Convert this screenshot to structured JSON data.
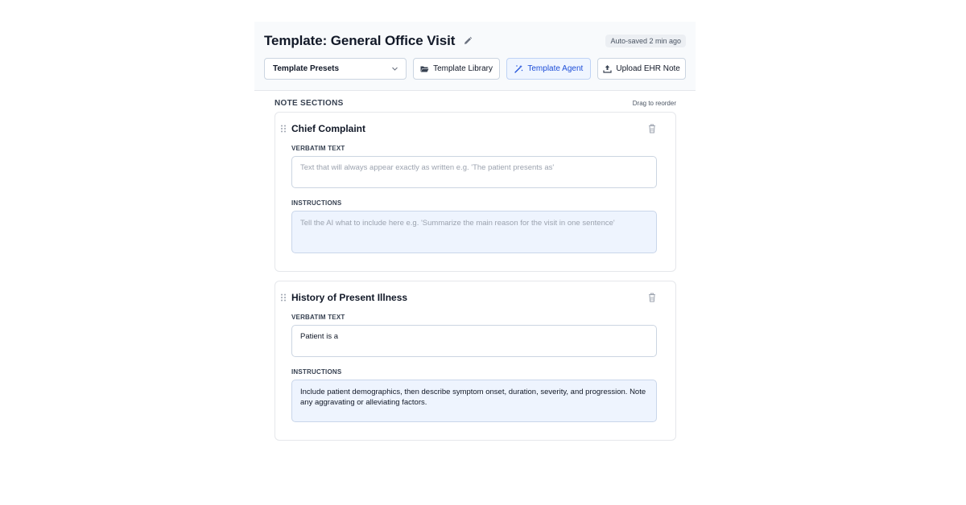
{
  "header": {
    "title": "Template: General Office Visit",
    "autosave": "Auto-saved 2 min ago"
  },
  "toolbar": {
    "preset_select": "Template Presets",
    "library_label": "Template Library",
    "agent_label": "Template Agent",
    "upload_label": "Upload EHR Note"
  },
  "sections": {
    "heading": "NOTE SECTIONS",
    "drag_hint": "Drag to reorder",
    "verbatim_label": "VERBATIM TEXT",
    "instructions_label": "INSTRUCTIONS",
    "items": [
      {
        "title": "Chief Complaint",
        "verbatim_value": "",
        "verbatim_placeholder": "Text that will always appear exactly as written e.g. 'The patient presents as'",
        "instructions_value": "",
        "instructions_placeholder": "Tell the AI what to include here e.g. 'Summarize the main reason for the visit in one sentence'"
      },
      {
        "title": "History of Present Illness",
        "verbatim_value": "Patient is a",
        "verbatim_placeholder": "",
        "instructions_value": "Include patient demographics, then describe symptom onset, duration, severity, and progression. Note any aggravating or alleviating factors.",
        "instructions_placeholder": ""
      }
    ]
  },
  "colors": {
    "accent": "#1d4ed8",
    "instructions_bg": "#eef4fe",
    "border": "#cbd5e1"
  },
  "icons": {
    "edit": "pencil-icon",
    "dropdown": "chevron-down-icon",
    "library": "folder-open-icon",
    "agent": "magic-wand-icon",
    "upload": "upload-icon",
    "reorder": "drag-handle-icon",
    "delete": "trash-icon"
  }
}
